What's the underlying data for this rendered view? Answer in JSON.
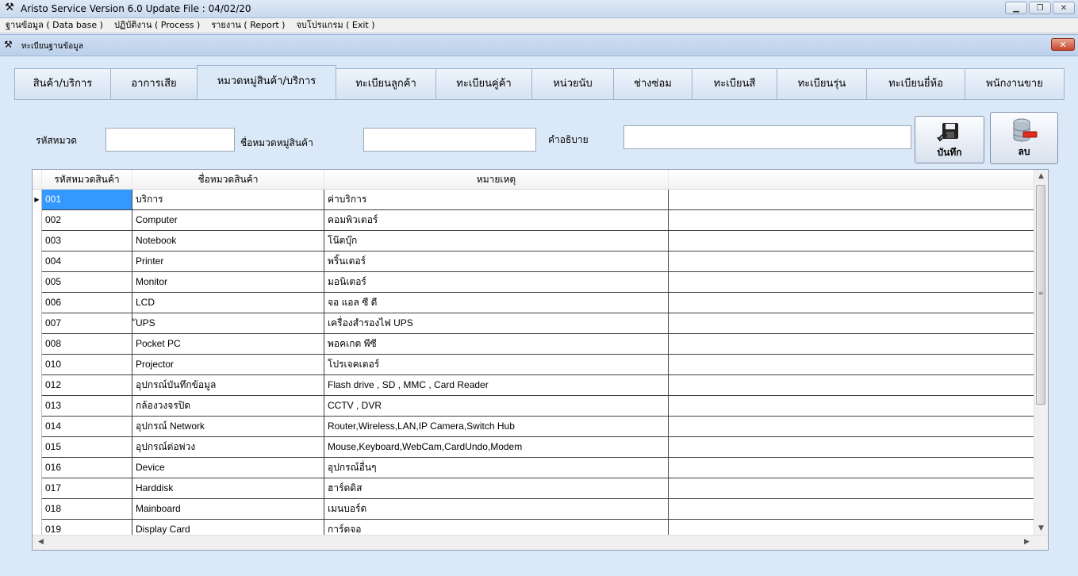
{
  "window": {
    "title": "Aristo Service Version 6.0 Update File : 04/02/20"
  },
  "menu": [
    "ฐานข้อมูล ( Data base )",
    "ปฏิบัติงาน ( Process )",
    "รายงาน ( Report )",
    "จบโปรแกรม ( Exit )"
  ],
  "child": {
    "title": "ทะเบียนฐานข้อมูล",
    "close": "✕"
  },
  "tabs": [
    {
      "label": "สินค้า/บริการ"
    },
    {
      "label": "อาการเสีย"
    },
    {
      "label": "หมวดหมู่สินค้า/บริการ"
    },
    {
      "label": "ทะเบียนลูกค้า"
    },
    {
      "label": "ทะเบียนคู่ค้า"
    },
    {
      "label": "หน่วยนับ"
    },
    {
      "label": "ช่างซ่อม"
    },
    {
      "label": "ทะเบียนสี"
    },
    {
      "label": "ทะเบียนรุ่น"
    },
    {
      "label": "ทะเบียนยี่ห้อ"
    },
    {
      "label": "พนักงานขาย"
    }
  ],
  "form": {
    "code_label": "รหัสหมวด",
    "code_value": "",
    "name_label": "ชื่อหมวดหมู่สินค้า",
    "name_value": "",
    "desc_label": "คำอธิบาย",
    "desc_value": ""
  },
  "buttons": {
    "save": "บันทึก",
    "delete": "ลบ"
  },
  "grid": {
    "columns": [
      "รหัสหมวดสินค้า",
      "ชื่อหมวดสินค้า",
      "หมายเหตุ",
      ""
    ],
    "rows": [
      {
        "code": "001",
        "name": "บริการ",
        "note": "ค่าบริการ"
      },
      {
        "code": "002",
        "name": "Computer",
        "note": "คอมพิวเตอร์"
      },
      {
        "code": "003",
        "name": "Notebook",
        "note": "โน๊ตบุ๊ก"
      },
      {
        "code": "004",
        "name": "Printer",
        "note": "พริ้นเตอร์"
      },
      {
        "code": "005",
        "name": "Monitor",
        "note": "มอนิเตอร์"
      },
      {
        "code": "006",
        "name": "LCD",
        "note": "จอ แอล ซี ดี"
      },
      {
        "code": "007",
        "name": "ัUPS",
        "note": "เครื่องสำรองไฟ UPS"
      },
      {
        "code": "008",
        "name": "Pocket PC",
        "note": "พอคเกต พีซี"
      },
      {
        "code": "010",
        "name": "Projector",
        "note": "โปรเจคเตอร์"
      },
      {
        "code": "012",
        "name": "อุปกรณ์บันทึกข้อมูล",
        "note": "Flash drive , SD , MMC , Card Reader"
      },
      {
        "code": "013",
        "name": "กล้องวงจรปิด",
        "note": "CCTV , DVR"
      },
      {
        "code": "014",
        "name": "อุปกรณ์ Network",
        "note": "Router,Wireless,LAN,IP Camera,Switch Hub"
      },
      {
        "code": "015",
        "name": "อุปกรณ์ต่อพ่วง",
        "note": "Mouse,Keyboard,WebCam,CardUndo,Modem"
      },
      {
        "code": "016",
        "name": "Device",
        "note": "อุปกรณ์อื่นๆ"
      },
      {
        "code": "017",
        "name": "Harddisk",
        "note": "ฮาร์ดดิส"
      },
      {
        "code": "018",
        "name": "Mainboard",
        "note": "เมนบอร์ด"
      },
      {
        "code": "019",
        "name": "Display Card",
        "note": "การ์ดจอ"
      }
    ]
  }
}
